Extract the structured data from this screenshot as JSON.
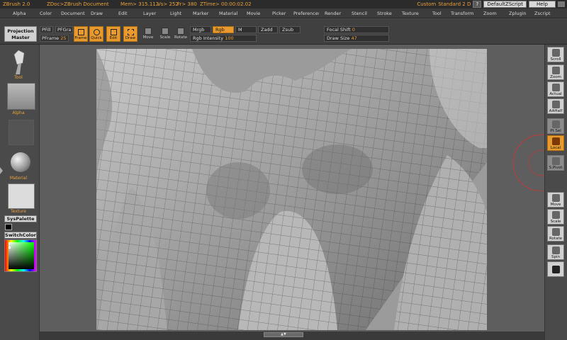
{
  "titlebar": {
    "app": "ZBrush 2.0",
    "document": "ZDoc>ZBrush Document",
    "mem": "Mem> 315.112",
    "vs": "Vs> 252",
    "fr": "Fr> 380",
    "ztime": "ZTime> 00:00:02.02",
    "custom": "Custom",
    "standard": "Standard 2 D",
    "help_q": "?",
    "script_btn": "DefaultZScript",
    "help_btn": "Help"
  },
  "menu": [
    "Alpha",
    "Color",
    "Document",
    "Draw",
    "Edit",
    "Layer",
    "Light",
    "Marker",
    "Material",
    "Movie",
    "Picker",
    "Preferences",
    "Render",
    "Stencil",
    "Stroke",
    "Texture",
    "Tool",
    "Transform",
    "Zoom",
    "Zplugin",
    "Zscript"
  ],
  "toolbar": {
    "projection_master_1": "Projection",
    "projection_master_2": "Master",
    "pfill": "PFill",
    "pfgra": "PFGra",
    "pframe_label": "PFrame",
    "pframe_value": "25",
    "frame": "Frame",
    "quick": "Quick",
    "edit": "Edit",
    "draw": "Draw",
    "move": "Move",
    "scale": "Scale",
    "rotate": "Rotate",
    "mrgb": "Mrgb",
    "rgb": "Rgb",
    "m": "M",
    "zadd": "Zadd",
    "zsub": "Zsub",
    "rgb_intensity_label": "Rgb Intensity",
    "rgb_intensity_value": "100",
    "focal_shift_label": "Focal Shift",
    "focal_shift_value": "0",
    "draw_size_label": "Draw Size",
    "draw_size_value": "47"
  },
  "left_tray": {
    "tool": "Tool",
    "alpha": "Alpha",
    "material": "Material",
    "texture": "Texture",
    "syspalette": "SysPalette",
    "switchcolor": "SwitchColor"
  },
  "right_tray": {
    "scroll": "Scroll",
    "zoom": "Zoom",
    "actual": "Actual",
    "aahalf": "AAHalf",
    "pt_sel": "Pt Sel",
    "local": "Local",
    "s_pivot": "S.Pivot",
    "move": "Move",
    "scale": "Scale",
    "rotate": "Rotate",
    "spin": "Spin"
  },
  "colors": {
    "accent": "#e89a2e",
    "title_text": "#e8a23a",
    "panel": "#404040",
    "viewport": "#9c9c9c"
  }
}
